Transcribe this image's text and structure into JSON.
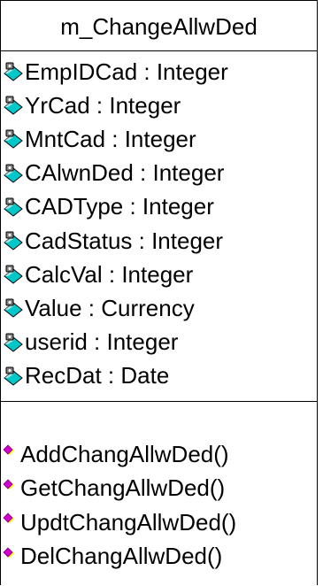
{
  "class_name": "m_ChangeAllwDed",
  "attributes": [
    {
      "label": "EmpIDCad : Integer",
      "icon": "protected-attribute-icon"
    },
    {
      "label": "YrCad : Integer",
      "icon": "protected-attribute-icon"
    },
    {
      "label": "MntCad : Integer",
      "icon": "protected-attribute-icon"
    },
    {
      "label": "CAlwnDed : Integer",
      "icon": "protected-attribute-icon"
    },
    {
      "label": "CADType : Integer",
      "icon": "protected-attribute-icon"
    },
    {
      "label": "CadStatus : Integer",
      "icon": "protected-attribute-icon"
    },
    {
      "label": "CalcVal : Integer",
      "icon": "protected-attribute-icon"
    },
    {
      "label": "Value : Currency",
      "icon": "protected-attribute-icon"
    },
    {
      "label": "userid : Integer",
      "icon": "protected-attribute-icon"
    },
    {
      "label": "RecDat : Date",
      "icon": "protected-attribute-icon"
    }
  ],
  "operations": [
    {
      "label": "AddChangAllwDed()",
      "icon": "public-operation-icon"
    },
    {
      "label": "GetChangAllwDed()",
      "icon": "public-operation-icon"
    },
    {
      "label": "UpdtChangAllwDed()",
      "icon": "public-operation-icon"
    },
    {
      "label": "DelChangAllwDed()",
      "icon": "public-operation-icon"
    }
  ],
  "colors": {
    "attribute_icon_fill": "#00c8c8",
    "attribute_icon_dark": "#808080",
    "operation_icon_fill": "#d000d0",
    "operation_icon_shadow": "#ffff00"
  }
}
